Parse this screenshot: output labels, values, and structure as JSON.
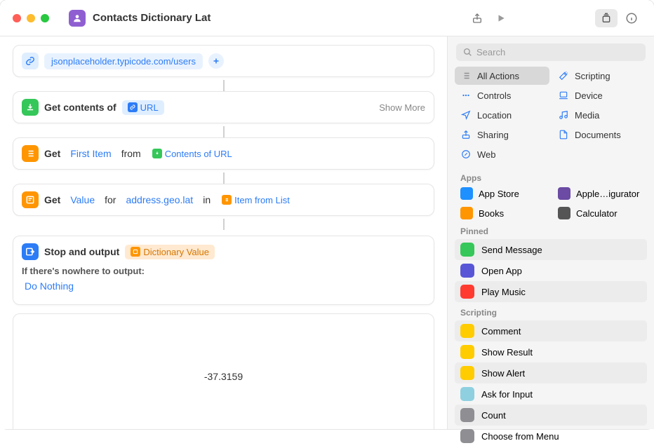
{
  "title": "Contacts Dictionary Lat",
  "url_action": {
    "url": "jsonplaceholder.typicode.com/users"
  },
  "get_contents": {
    "label": "Get contents of",
    "var": "URL",
    "show_more": "Show More"
  },
  "get_item": {
    "label_get": "Get",
    "token": "First Item",
    "from": "from",
    "var": "Contents of URL"
  },
  "get_value": {
    "label_get": "Get",
    "token_value": "Value",
    "for": "for",
    "path": "address.geo.lat",
    "in": "in",
    "var": "Item from List"
  },
  "stop_output": {
    "label": "Stop and output",
    "var": "Dictionary Value",
    "nowhere": "If there's nowhere to output:",
    "do_nothing": "Do Nothing"
  },
  "result": "-37.3159",
  "search": {
    "placeholder": "Search"
  },
  "categories": [
    {
      "icon": "list",
      "label": "All Actions",
      "selected": true,
      "color": "#8e8e93"
    },
    {
      "icon": "wand",
      "label": "Scripting",
      "color": "#2c7cf6"
    },
    {
      "icon": "dots",
      "label": "Controls",
      "color": "#2c7cf6"
    },
    {
      "icon": "device",
      "label": "Device",
      "color": "#2c7cf6"
    },
    {
      "icon": "nav",
      "label": "Location",
      "color": "#2c7cf6"
    },
    {
      "icon": "music",
      "label": "Media",
      "color": "#2c7cf6"
    },
    {
      "icon": "share",
      "label": "Sharing",
      "color": "#2c7cf6"
    },
    {
      "icon": "doc",
      "label": "Documents",
      "color": "#2c7cf6"
    },
    {
      "icon": "safari",
      "label": "Web",
      "color": "#2c7cf6"
    }
  ],
  "apps_label": "Apps",
  "apps": [
    {
      "label": "App Store",
      "color": "#1e90ff"
    },
    {
      "label": "Apple…igurator",
      "color": "#6b4ba3"
    },
    {
      "label": "Books",
      "color": "#ff9500"
    },
    {
      "label": "Calculator",
      "color": "#555"
    }
  ],
  "pinned_label": "Pinned",
  "pinned": [
    {
      "label": "Send Message",
      "color": "#35c759",
      "striped": true
    },
    {
      "label": "Open App",
      "color": "#5856d6",
      "striped": false
    },
    {
      "label": "Play Music",
      "color": "#ff3b30",
      "striped": true
    }
  ],
  "scripting_label": "Scripting",
  "scripting": [
    {
      "label": "Comment",
      "color": "#ffcc00",
      "striped": true
    },
    {
      "label": "Show Result",
      "color": "#ffcc00",
      "striped": false
    },
    {
      "label": "Show Alert",
      "color": "#ffcc00",
      "striped": true
    },
    {
      "label": "Ask for Input",
      "color": "#8ed0e0",
      "striped": false
    },
    {
      "label": "Count",
      "color": "#8e8e93",
      "striped": true
    },
    {
      "label": "Choose from Menu",
      "color": "#8e8e93",
      "striped": false
    }
  ]
}
